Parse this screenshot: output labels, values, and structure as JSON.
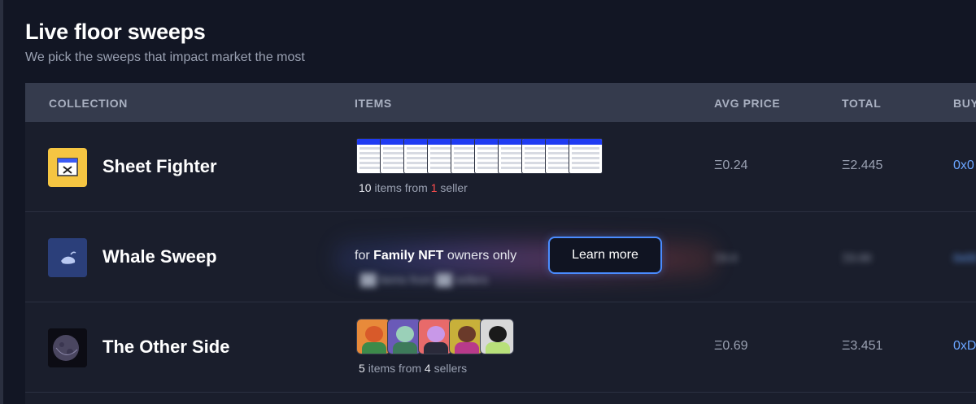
{
  "header": {
    "title": "Live floor sweeps",
    "subtitle": "We pick the sweeps that impact market the most"
  },
  "table": {
    "columns": [
      "COLLECTION",
      "ITEMS",
      "AVG PRICE",
      "TOTAL",
      "BUY"
    ],
    "rows": [
      {
        "collection": "Sheet Fighter",
        "items_count": "10",
        "items_from": "items from",
        "sellers_count": "1",
        "sellers_label": "seller",
        "avg_price": "Ξ0.24",
        "total": "Ξ2.445",
        "buyer": "0x0"
      },
      {
        "collection": "Whale Sweep",
        "locked_prefix": "for",
        "locked_bold": "Family NFT",
        "locked_suffix": "owners only",
        "learn_more": "Learn more"
      },
      {
        "collection": "The Other Side",
        "items_count": "5",
        "items_from": "items from",
        "sellers_count": "4",
        "sellers_label": "sellers",
        "avg_price": "Ξ0.69",
        "total": "Ξ3.451",
        "buyer": "0xD"
      }
    ]
  },
  "colors": {
    "background": "#121624",
    "header_bg": "#353b4d",
    "accent_blue": "#4a8cff",
    "buyer_link": "#6aa5ff",
    "seller_highlight": "#ff4d4d",
    "sheet_fighter_icon": "#f5c542"
  },
  "icons": {
    "sheet_fighter": "spreadsheet-window-icon",
    "whale_sweep": "whale-icon",
    "the_other_side": "moon-planet-icon"
  }
}
